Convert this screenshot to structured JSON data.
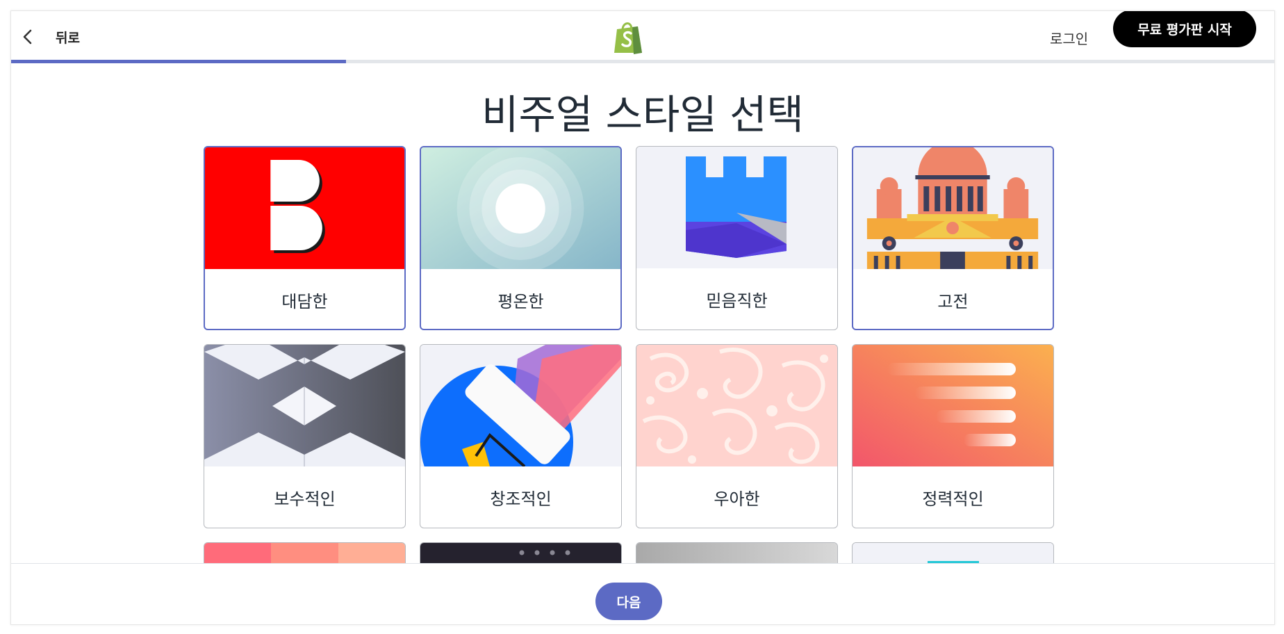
{
  "header": {
    "back_label": "뒤로",
    "login_label": "로그인",
    "trial_label": "무료 평가판 시작",
    "progress": 0.265
  },
  "page_title": "비주얼 스타일 선택",
  "styles": [
    {
      "label": "대담한",
      "selected": true
    },
    {
      "label": "평온한",
      "selected": true
    },
    {
      "label": "믿음직한",
      "selected": false
    },
    {
      "label": "고전",
      "selected": true
    },
    {
      "label": "보수적인",
      "selected": false
    },
    {
      "label": "창조적인",
      "selected": false
    },
    {
      "label": "우아한",
      "selected": false
    },
    {
      "label": "정력적인",
      "selected": false
    }
  ],
  "footer": {
    "next_label": "다음"
  },
  "colors": {
    "accent": "#5c6ac4",
    "primary_button": "#000000",
    "brand_green": "#95bf47"
  }
}
